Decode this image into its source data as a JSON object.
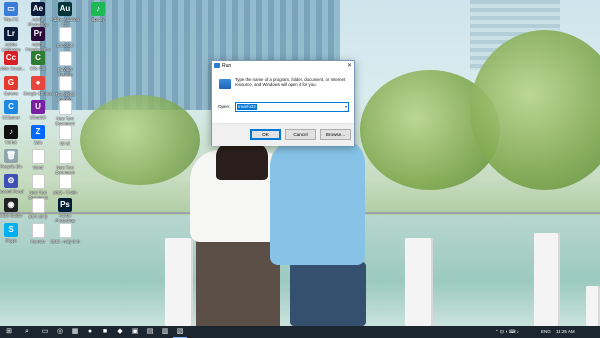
{
  "desktop_icons": [
    {
      "label": "This PC",
      "color": "#3a7bd5",
      "glyph": "▭"
    },
    {
      "label": "Adobe Photoshop",
      "color": "#0a1c3a",
      "glyph": "Ae"
    },
    {
      "label": "Adobe Audition CC",
      "color": "#00363a",
      "glyph": "Au"
    },
    {
      "label": "Spotify",
      "color": "#1db954",
      "glyph": "♪"
    },
    {
      "label": "Adobe Lightroom",
      "color": "#0a1c3a",
      "glyph": "Lr"
    },
    {
      "label": "Adobe Premiere Pro",
      "color": "#2a0a3a",
      "glyph": "Pr"
    },
    {
      "label": "Cocosoft",
      "color": "#ffffff",
      "glyph": ""
    },
    {
      "label": "Adobe Creati...",
      "color": "#da1f26",
      "glyph": "Cc"
    },
    {
      "label": "Cốc Cốc",
      "color": "#2e7d32",
      "glyph": "C"
    },
    {
      "label": "DaVinci Resolve",
      "color": "#ffffff",
      "glyph": ""
    },
    {
      "label": "Garena",
      "color": "#e23b2e",
      "glyph": "G"
    },
    {
      "label": "Google Chrome",
      "color": "#e8453c",
      "glyph": "●"
    },
    {
      "label": "Tiếu đề dễ thương",
      "color": "#ffffff",
      "glyph": ""
    },
    {
      "label": "CCleaner",
      "color": "#1e88e5",
      "glyph": "C"
    },
    {
      "label": "UltraISO",
      "color": "#7b1fa2",
      "glyph": "U"
    },
    {
      "label": "New Text Document",
      "color": "#ffffff",
      "glyph": ""
    },
    {
      "label": "TikTok",
      "color": "#111111",
      "glyph": "♪"
    },
    {
      "label": "Zalo",
      "color": "#0068ff",
      "glyph": "Z"
    },
    {
      "label": "tải về",
      "color": "#ffffff",
      "glyph": ""
    },
    {
      "label": "Recycle Bin",
      "color": "#90a4ae",
      "glyph": "🗑"
    },
    {
      "label": "Word",
      "color": "#ffffff",
      "glyph": ""
    },
    {
      "label": "New Text Document",
      "color": "#ffffff",
      "glyph": ""
    },
    {
      "label": "Control Panel",
      "color": "#3f51b5",
      "glyph": "⚙"
    },
    {
      "label": "New Text Document",
      "color": "#ffffff",
      "glyph": ""
    },
    {
      "label": "2013 - Ti tiến",
      "color": "#ffffff",
      "glyph": ""
    },
    {
      "label": "OBS Studio",
      "color": "#222222",
      "glyph": "◉"
    },
    {
      "label": "BC4 xử lý",
      "color": "#ffffff",
      "glyph": ""
    },
    {
      "label": "Adobe Photoshop",
      "color": "#001e36",
      "glyph": "Ps"
    },
    {
      "label": "Skype",
      "color": "#00aff0",
      "glyph": "S"
    },
    {
      "label": "Kernutz",
      "color": "#ffffff",
      "glyph": ""
    },
    {
      "label": "2013 - máy tính",
      "color": "#ffffff",
      "glyph": ""
    }
  ],
  "run_dialog": {
    "title": "Run",
    "close": "✕",
    "description": "Type the name of a program, folder, document, or Internet resource, and Windows will open it for you.",
    "open_label": "Open:",
    "input_value": "msinfo32",
    "dropdown_glyph": "▾",
    "ok": "OK",
    "cancel": "Cancel",
    "browse": "Browse..."
  },
  "taskbar": {
    "start_glyph": "⊞",
    "search_glyph": "⌕",
    "pinned": [
      "▭",
      "◎",
      "▦",
      "●",
      "■",
      "◆",
      "▣",
      "▤",
      "▥",
      "▧"
    ],
    "tray": {
      "icons": "⌃  ⊡  ◖  ⌨  ♪",
      "language": "ENG",
      "time": "11:25 AM"
    }
  }
}
